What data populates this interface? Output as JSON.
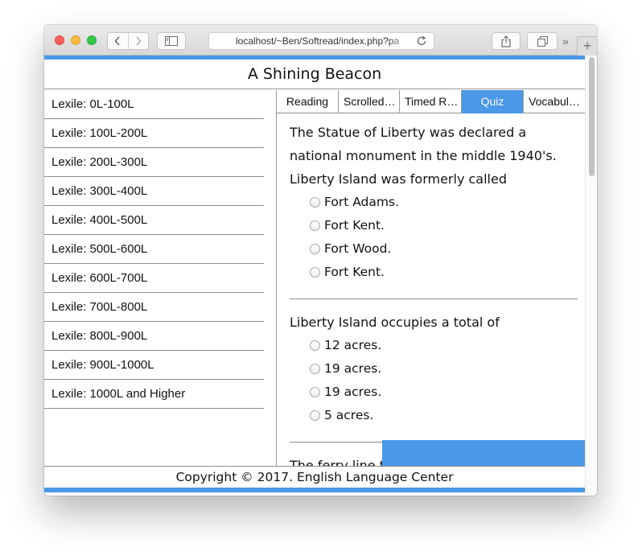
{
  "browser": {
    "url": "localhost/~Ben/Softread/index.php?pa",
    "more_glyph": "»",
    "new_tab_glyph": "+"
  },
  "page": {
    "title": "A Shining Beacon",
    "footer": "Copyright © 2017. English Language Center",
    "accent_color": "#4a98e7"
  },
  "sidebar": {
    "items": [
      {
        "label": "Lexile: 0L-100L"
      },
      {
        "label": "Lexile: 100L-200L"
      },
      {
        "label": "Lexile: 200L-300L"
      },
      {
        "label": "Lexile: 300L-400L"
      },
      {
        "label": "Lexile: 400L-500L"
      },
      {
        "label": "Lexile: 500L-600L"
      },
      {
        "label": "Lexile: 600L-700L"
      },
      {
        "label": "Lexile: 700L-800L"
      },
      {
        "label": "Lexile: 800L-900L"
      },
      {
        "label": "Lexile: 900L-1000L"
      },
      {
        "label": "Lexile: 1000L and Higher"
      }
    ]
  },
  "tabs": [
    {
      "label": "Reading",
      "active": false
    },
    {
      "label": "Scrolled…",
      "active": false
    },
    {
      "label": "Timed R…",
      "active": false
    },
    {
      "label": "Quiz",
      "active": true
    },
    {
      "label": "Vocabul…",
      "active": false
    }
  ],
  "quiz": {
    "questions": [
      {
        "text": "The Statue of Liberty was declared a national monument in the middle 1940's. Liberty Island was formerly called",
        "options": [
          "Fort Adams.",
          "Fort Kent.",
          "Fort Wood.",
          "Fort Kent."
        ]
      },
      {
        "text": "Liberty Island occupies a total of",
        "options": [
          "12 acres.",
          "19 acres.",
          "19 acres.",
          "5 acres."
        ]
      },
      {
        "text": "The ferry line that serves the Statue is",
        "options": []
      }
    ]
  }
}
